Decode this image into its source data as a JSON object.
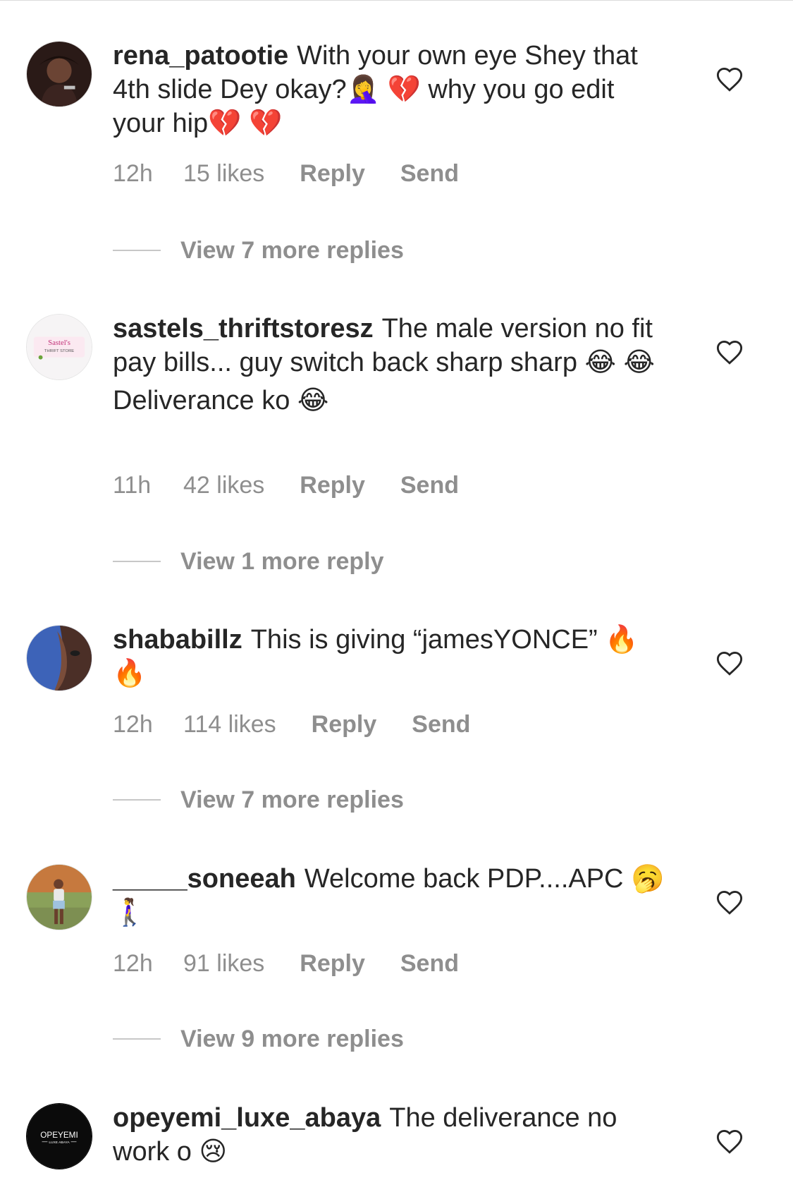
{
  "comments": [
    {
      "username": "rena_patootie",
      "text": "With your own eye Shey that 4th slide Dey okay?🤦‍♀️ 💔 why you go edit your hip💔 💔",
      "extra": "",
      "time": "12h",
      "likes": "15 likes",
      "reply_label": "Reply",
      "send_label": "Send",
      "view_replies": "View 7 more replies",
      "like_icon": "heart-outline-icon"
    },
    {
      "username": "sastels_thriftstoresz",
      "text": "The male version no fit pay bills... guy switch back sharp sharp 😂 😂",
      "extra": "Deliverance ko 😂",
      "time": "11h",
      "likes": "42 likes",
      "reply_label": "Reply",
      "send_label": "Send",
      "view_replies": "View 1 more reply",
      "like_icon": "heart-outline-icon"
    },
    {
      "username": "shababillz",
      "text": "This is giving “jamesYONCE” 🔥 🔥",
      "extra": "",
      "time": "12h",
      "likes": "114 likes",
      "reply_label": "Reply",
      "send_label": "Send",
      "view_replies": "View 7 more replies",
      "like_icon": "heart-outline-icon"
    },
    {
      "username": "_____soneeah",
      "text": "Welcome back PDP....APC 🥱 🚶‍♀️",
      "extra": "",
      "time": "12h",
      "likes": "91 likes",
      "reply_label": "Reply",
      "send_label": "Send",
      "view_replies": "View 9 more replies",
      "like_icon": "heart-outline-icon"
    },
    {
      "username": "opeyemi_luxe_abaya",
      "text": "The deliverance no work o 😢",
      "extra": "",
      "like_icon": "heart-outline-icon",
      "avatar_logo": {
        "name": "OPEYEMI",
        "tagline": "LUXE ABAYA"
      }
    }
  ],
  "colors": {
    "text": "#262626",
    "secondary": "#8e8e8e",
    "divider": "#dbdbdb"
  }
}
